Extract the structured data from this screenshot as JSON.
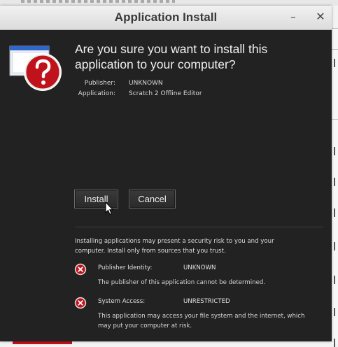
{
  "window": {
    "title": "Application Install",
    "minimize_label": "–",
    "close_label": "✕"
  },
  "dialog": {
    "heading": "Are you sure you want to install this application to your computer?",
    "publisher_label": "Publisher:",
    "publisher_value": "UNKNOWN",
    "application_label": "Application:",
    "application_value": "Scratch 2 Offline Editor",
    "install_label": "Install",
    "cancel_label": "Cancel",
    "warning": "Installing applications may present a security risk to you and your computer. Install only from sources that you trust.",
    "risks": [
      {
        "label": "Publisher Identity:",
        "value": "UNKNOWN",
        "description": "The publisher of this application cannot be determined."
      },
      {
        "label": "System Access:",
        "value": "UNRESTRICTED",
        "description": "This application may access your file system and the internet, which may put your computer at risk."
      }
    ]
  },
  "icons": {
    "app": "question-window-icon",
    "risk": "red-x-icon",
    "pointer": "mouse-pointer-icon"
  },
  "colors": {
    "panel": "#222222",
    "accent_red": "#c0121b",
    "titlebar": "#e4e4e4"
  }
}
